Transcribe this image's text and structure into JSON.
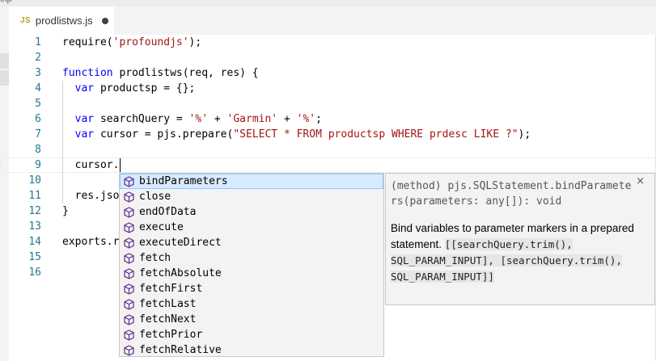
{
  "window": {
    "menu_fragment": "elp"
  },
  "tab": {
    "lang_icon": "JS",
    "filename": "prodlistws.js",
    "dirty_icon": "dirty-dot-icon"
  },
  "editor": {
    "line_numbers": [
      "1",
      "2",
      "3",
      "4",
      "5",
      "6",
      "7",
      "8",
      "9",
      "10",
      "11",
      "12",
      "13",
      "14",
      "15",
      "16"
    ],
    "lines": [
      [
        {
          "t": "require("
        },
        {
          "t": "'profoundjs'",
          "c": "str"
        },
        {
          "t": ");"
        }
      ],
      [],
      [
        {
          "t": "function",
          "c": "kw"
        },
        {
          "t": " prodlistws(req, res) {"
        }
      ],
      [
        {
          "t": "  "
        },
        {
          "t": "var",
          "c": "kw"
        },
        {
          "t": " productsp = {};"
        }
      ],
      [],
      [
        {
          "t": "  "
        },
        {
          "t": "var",
          "c": "kw"
        },
        {
          "t": " searchQuery = "
        },
        {
          "t": "'%'",
          "c": "str"
        },
        {
          "t": " + "
        },
        {
          "t": "'Garmin'",
          "c": "str"
        },
        {
          "t": " + "
        },
        {
          "t": "'%'",
          "c": "str"
        },
        {
          "t": ";"
        }
      ],
      [
        {
          "t": "  "
        },
        {
          "t": "var",
          "c": "kw"
        },
        {
          "t": " cursor = pjs.prepare("
        },
        {
          "t": "\"SELECT * FROM productsp WHERE prdesc LIKE ?\"",
          "c": "str"
        },
        {
          "t": ");"
        }
      ],
      [],
      [
        {
          "t": "  cursor."
        }
      ],
      [],
      [
        {
          "t": "  res.jso"
        }
      ],
      [
        {
          "t": "}"
        }
      ],
      [],
      [
        {
          "t": "exports.r"
        }
      ],
      [],
      []
    ]
  },
  "suggestions": {
    "item_icon": "method-cube-icon",
    "items": [
      "bindParameters",
      "close",
      "endOfData",
      "execute",
      "executeDirect",
      "fetch",
      "fetchAbsolute",
      "fetchFirst",
      "fetchLast",
      "fetchNext",
      "fetchPrior",
      "fetchRelative"
    ],
    "selected_index": 0
  },
  "details": {
    "signature": "(method) pjs.SQLStatement.bindParameters(parameters: any[]): void",
    "close_label": "×",
    "doc_text": "Bind variables to parameter markers in a prepared statement. ",
    "doc_code": "[[searchQuery.trim(), SQL_PARAM_INPUT], [searchQuery.trim(), SQL_PARAM_INPUT]]"
  },
  "colors": {
    "keyword": "#0000ff",
    "string": "#a31515",
    "line_number": "#237893",
    "selection": "#d6ebff"
  }
}
